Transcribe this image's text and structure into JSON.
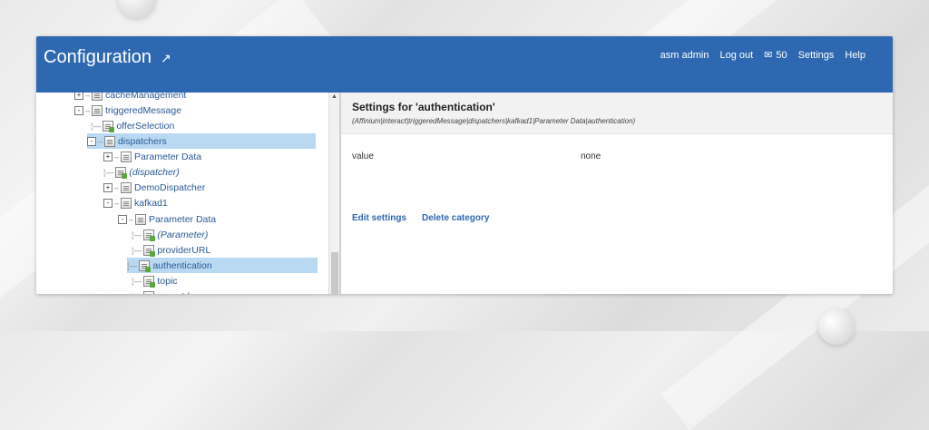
{
  "header": {
    "title": "Configuration",
    "title_icon": "external-link-icon",
    "user": "asm admin",
    "logout": "Log out",
    "mail_count": "50",
    "settings": "Settings",
    "help": "Help",
    "brand_color": "#2e68b1"
  },
  "tree": [
    {
      "label": "cacheManagement",
      "expander": "+",
      "italic": false,
      "selected": false
    },
    {
      "label": "triggeredMessage",
      "expander": "-",
      "italic": false,
      "selected": false
    },
    {
      "label": "offerSelection",
      "expander": "",
      "italic": false,
      "selected": false
    },
    {
      "label": "dispatchers",
      "expander": "-",
      "italic": false,
      "selected": true
    },
    {
      "label": "Parameter Data",
      "expander": "+",
      "italic": false,
      "selected": false
    },
    {
      "label": "(dispatcher)",
      "expander": "",
      "italic": true,
      "selected": false
    },
    {
      "label": "DemoDispatcher",
      "expander": "+",
      "italic": false,
      "selected": false
    },
    {
      "label": "kafkad1",
      "expander": "-",
      "italic": false,
      "selected": false
    },
    {
      "label": "Parameter Data",
      "expander": "-",
      "italic": false,
      "selected": false
    },
    {
      "label": "(Parameter)",
      "expander": "",
      "italic": true,
      "selected": false
    },
    {
      "label": "providerURL",
      "expander": "",
      "italic": false,
      "selected": false
    },
    {
      "label": "authentication",
      "expander": "",
      "italic": false,
      "selected": true
    },
    {
      "label": "topic",
      "expander": "",
      "italic": false,
      "selected": false
    },
    {
      "label": "groupId",
      "expander": "",
      "italic": false,
      "selected": false
    }
  ],
  "settings": {
    "heading": "Settings for 'authentication'",
    "path": "(Affinium|interact|triggeredMessage|dispatchers|kafkad1|Parameter Data|authentication)",
    "key": "value",
    "val": "none",
    "edit": "Edit settings",
    "delete": "Delete category"
  }
}
